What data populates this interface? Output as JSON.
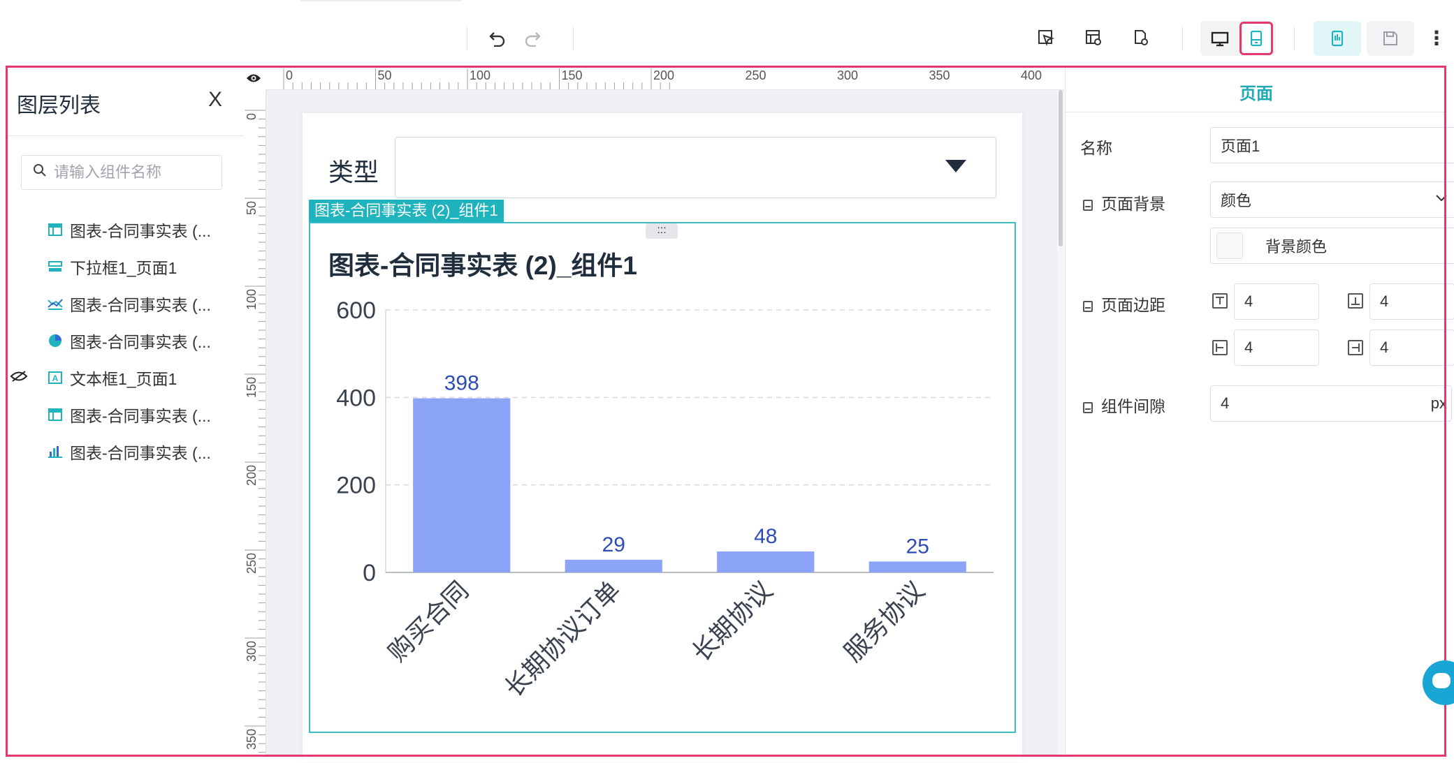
{
  "toolbar": {
    "undo_icon": "undo-icon",
    "redo_icon": "redo-icon",
    "tools": [
      "select-tool-icon",
      "layout-settings-icon",
      "page-settings-icon"
    ],
    "device_modes": [
      "desktop-icon",
      "mobile-icon"
    ],
    "active_device": "mobile",
    "actions": [
      "preview-icon",
      "save-icon",
      "more-icon"
    ],
    "accent": "#1fb3be",
    "highlight_border": "#e5386d"
  },
  "layers": {
    "title": "图层列表",
    "close_label": "X",
    "search_placeholder": "请输入组件名称",
    "items": [
      {
        "label": "图表-合同事实表 (...",
        "icon": "table-icon",
        "hidden": false
      },
      {
        "label": "下拉框1_页面1",
        "icon": "dropdown-icon",
        "hidden": false
      },
      {
        "label": "图表-合同事实表 (...",
        "icon": "line-chart-icon",
        "hidden": false
      },
      {
        "label": "图表-合同事实表 (...",
        "icon": "pie-chart-icon",
        "hidden": false
      },
      {
        "label": "文本框1_页面1",
        "icon": "text-box-icon",
        "hidden": true
      },
      {
        "label": "图表-合同事实表 (...",
        "icon": "table-icon",
        "hidden": false
      },
      {
        "label": "图表-合同事实表 (...",
        "icon": "bar-chart-icon",
        "hidden": false
      }
    ]
  },
  "ruler": {
    "h_labels": [
      "0",
      "50",
      "100",
      "150",
      "200",
      "250",
      "300",
      "350",
      "400"
    ],
    "v_labels": [
      "0",
      "50",
      "100",
      "150",
      "200",
      "250",
      "300",
      "350"
    ]
  },
  "canvas": {
    "filter_label": "类型",
    "filter_value": "",
    "component_tag": "图表-合同事实表 (2)_组件1",
    "drag_handle": ":::",
    "chart_title": "图表-合同事实表 (2)_组件1"
  },
  "chart_data": {
    "type": "bar",
    "title": "图表-合同事实表 (2)_组件1",
    "categories": [
      "购买合同",
      "长期协议订单",
      "长期协议",
      "服务协议"
    ],
    "values": [
      398,
      29,
      48,
      25
    ],
    "yticks": [
      0,
      200,
      400,
      600
    ],
    "ylim": [
      0,
      600
    ],
    "grid": true,
    "bar_color": "#8ba4f7",
    "label_color": "#2f4bb5",
    "xlabel": "",
    "ylabel": ""
  },
  "properties": {
    "title": "页面",
    "name_label": "名称",
    "name_value": "页面1",
    "bg_label": "页面背景",
    "bg_type": "颜色",
    "bg_color_label": "背景颜色",
    "margin_label": "页面边距",
    "margin_top": "4",
    "margin_bottom": "4",
    "margin_left": "4",
    "margin_right": "4",
    "gap_label": "组件间隙",
    "gap_value": "4",
    "gap_unit": "px"
  }
}
